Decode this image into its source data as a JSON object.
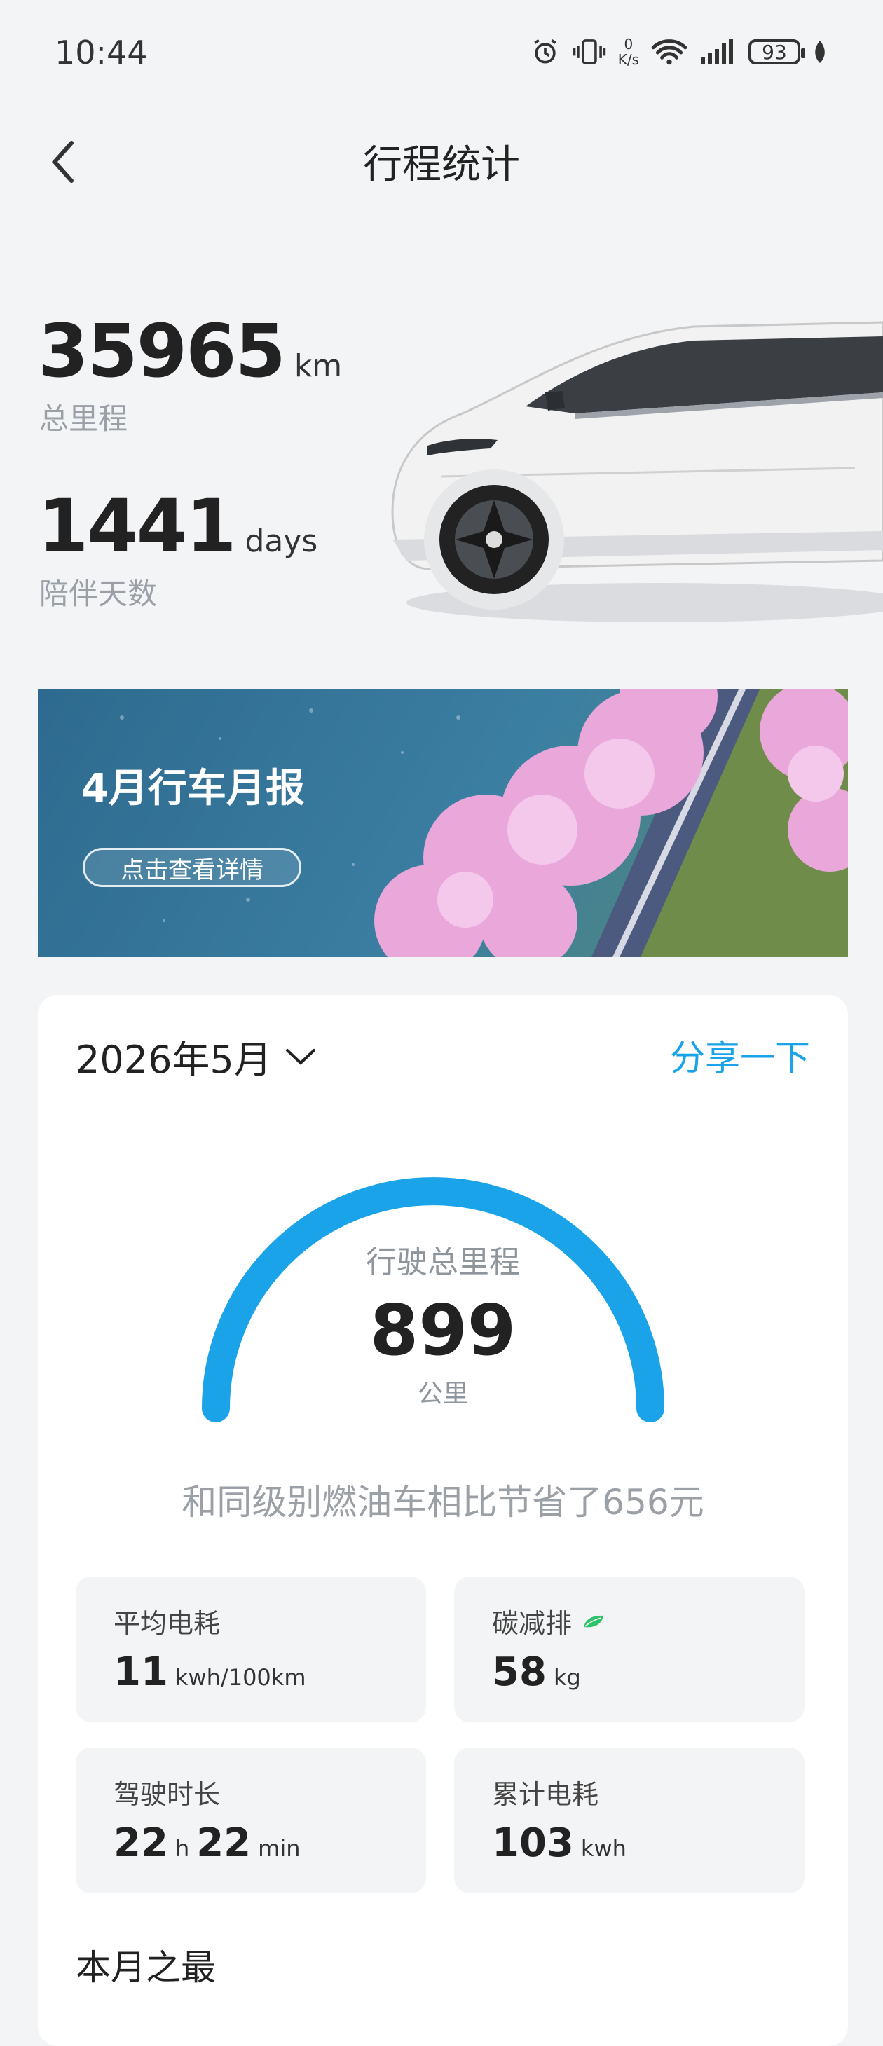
{
  "status_bar": {
    "time": "10:44",
    "net_speed_value": "0",
    "net_speed_unit": "K/s",
    "battery": "93"
  },
  "header": {
    "title": "行程统计"
  },
  "stats": {
    "mileage": {
      "value": "35965",
      "unit": "km",
      "label": "总里程"
    },
    "days": {
      "value": "1441",
      "unit": "days",
      "label": "陪伴天数"
    }
  },
  "banner": {
    "title": "4月行车月报",
    "button": "点击查看详情"
  },
  "card": {
    "month": "2026年5月",
    "share": "分享一下",
    "gauge": {
      "label": "行驶总里程",
      "value": "899",
      "unit": "公里",
      "fill": 1.0
    },
    "saving": "和同级别燃油车相比节省了656元",
    "metrics": {
      "avg_consumption": {
        "label": "平均电耗",
        "value": "11",
        "unit": "kwh/100km"
      },
      "carbon": {
        "label": "碳减排",
        "value": "58",
        "unit": "kg"
      },
      "duration": {
        "label": "驾驶时长",
        "hours": "22",
        "h_unit": "h",
        "minutes": "22",
        "m_unit": "min"
      },
      "total_consumption": {
        "label": "累计电耗",
        "value": "103",
        "unit": "kwh"
      }
    },
    "section_title": "本月之最"
  },
  "colors": {
    "accent": "#1aa3e8",
    "leaf": "#2ec26a"
  }
}
